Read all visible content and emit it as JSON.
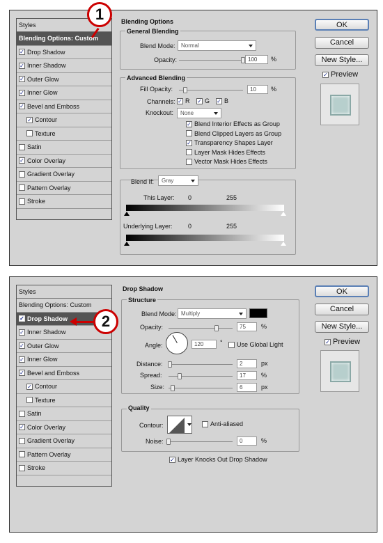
{
  "panel1": {
    "styles_header": "Styles",
    "styles": [
      {
        "label": "Blending Options: Custom",
        "checkbox": false,
        "checked": false,
        "indent": false,
        "selected": true
      },
      {
        "label": "Drop Shadow",
        "checkbox": true,
        "checked": true,
        "indent": false,
        "selected": false
      },
      {
        "label": "Inner Shadow",
        "checkbox": true,
        "checked": true,
        "indent": false,
        "selected": false
      },
      {
        "label": "Outer Glow",
        "checkbox": true,
        "checked": true,
        "indent": false,
        "selected": false
      },
      {
        "label": "Inner Glow",
        "checkbox": true,
        "checked": true,
        "indent": false,
        "selected": false
      },
      {
        "label": "Bevel and Emboss",
        "checkbox": true,
        "checked": true,
        "indent": false,
        "selected": false
      },
      {
        "label": "Contour",
        "checkbox": true,
        "checked": true,
        "indent": true,
        "selected": false
      },
      {
        "label": "Texture",
        "checkbox": true,
        "checked": false,
        "indent": true,
        "selected": false
      },
      {
        "label": "Satin",
        "checkbox": true,
        "checked": false,
        "indent": false,
        "selected": false
      },
      {
        "label": "Color Overlay",
        "checkbox": true,
        "checked": true,
        "indent": false,
        "selected": false
      },
      {
        "label": "Gradient Overlay",
        "checkbox": true,
        "checked": false,
        "indent": false,
        "selected": false
      },
      {
        "label": "Pattern Overlay",
        "checkbox": true,
        "checked": false,
        "indent": false,
        "selected": false
      },
      {
        "label": "Stroke",
        "checkbox": true,
        "checked": false,
        "indent": false,
        "selected": false
      }
    ],
    "section_title": "Blending Options",
    "general": {
      "title": "General Blending",
      "blend_mode_label": "Blend Mode:",
      "blend_mode": "Normal",
      "opacity_label": "Opacity:",
      "opacity": "100",
      "opacity_level": 100,
      "unit": "%"
    },
    "advanced": {
      "title": "Advanced Blending",
      "fill_label": "Fill Opacity:",
      "fill": "10",
      "fill_level": 10,
      "unit": "%",
      "channels_label": "Channels:",
      "channels": [
        "R",
        "G",
        "B"
      ],
      "knockout_label": "Knockout:",
      "knockout": "None",
      "options": [
        {
          "label": "Blend Interior Effects as Group",
          "checked": true
        },
        {
          "label": "Blend Clipped Layers as Group",
          "checked": false
        },
        {
          "label": "Transparency Shapes Layer",
          "checked": true
        },
        {
          "label": "Layer Mask Hides Effects",
          "checked": false
        },
        {
          "label": "Vector Mask Hides Effects",
          "checked": false
        }
      ]
    },
    "blend_if": {
      "label": "Blend If:",
      "value": "Gray",
      "this_layer": "This Layer:",
      "underlying": "Underlying Layer:",
      "min": "0",
      "max": "255"
    },
    "callout": "1"
  },
  "panel2": {
    "styles_header": "Styles",
    "styles": [
      {
        "label": "Blending Options: Custom",
        "checkbox": false,
        "checked": false,
        "indent": false,
        "selected": false
      },
      {
        "label": "Drop Shadow",
        "checkbox": true,
        "checked": true,
        "indent": false,
        "selected": true
      },
      {
        "label": "Inner Shadow",
        "checkbox": true,
        "checked": true,
        "indent": false,
        "selected": false
      },
      {
        "label": "Outer Glow",
        "checkbox": true,
        "checked": true,
        "indent": false,
        "selected": false
      },
      {
        "label": "Inner Glow",
        "checkbox": true,
        "checked": true,
        "indent": false,
        "selected": false
      },
      {
        "label": "Bevel and Emboss",
        "checkbox": true,
        "checked": true,
        "indent": false,
        "selected": false
      },
      {
        "label": "Contour",
        "checkbox": true,
        "checked": true,
        "indent": true,
        "selected": false
      },
      {
        "label": "Texture",
        "checkbox": true,
        "checked": false,
        "indent": true,
        "selected": false
      },
      {
        "label": "Satin",
        "checkbox": true,
        "checked": false,
        "indent": false,
        "selected": false
      },
      {
        "label": "Color Overlay",
        "checkbox": true,
        "checked": true,
        "indent": false,
        "selected": false
      },
      {
        "label": "Gradient Overlay",
        "checkbox": true,
        "checked": false,
        "indent": false,
        "selected": false
      },
      {
        "label": "Pattern Overlay",
        "checkbox": true,
        "checked": false,
        "indent": false,
        "selected": false
      },
      {
        "label": "Stroke",
        "checkbox": true,
        "checked": false,
        "indent": false,
        "selected": false
      }
    ],
    "section_title": "Drop Shadow",
    "structure": {
      "title": "Structure",
      "blend_mode_label": "Blend Mode:",
      "blend_mode": "Multiply",
      "shadow_color": "#000000",
      "opacity_label": "Opacity:",
      "opacity": "75",
      "opacity_level": 75,
      "angle_label": "Angle:",
      "angle": "120",
      "degree": "°",
      "global_light": "Use Global Light",
      "distance_label": "Distance:",
      "distance": "2",
      "distance_level": 2,
      "spread_label": "Spread:",
      "spread": "17",
      "spread_level": 17,
      "size_label": "Size:",
      "size": "6",
      "size_level": 6,
      "px": "px",
      "pct": "%"
    },
    "quality": {
      "title": "Quality",
      "contour_label": "Contour:",
      "anti_aliased": "Anti-aliased",
      "noise_label": "Noise:",
      "noise": "0",
      "noise_level": 0,
      "pct": "%"
    },
    "knocks_out": "Layer Knocks Out Drop Shadow",
    "callout": "2"
  },
  "buttons": {
    "ok": "OK",
    "cancel": "Cancel",
    "new_style": "New Style...",
    "preview": "Preview"
  },
  "colors": {
    "accent": "#5a7fb5",
    "callout": "#cc0000",
    "selected_row": "#545454"
  }
}
